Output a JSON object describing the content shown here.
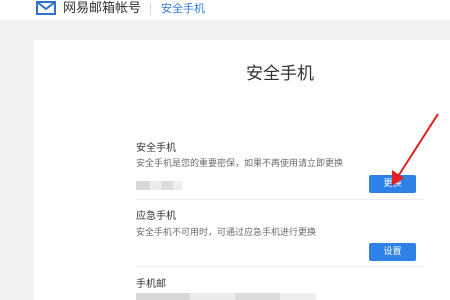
{
  "header": {
    "brand": "网易邮箱帐号",
    "link": "安全手机",
    "icon": "mail-envelope-icon"
  },
  "page": {
    "title": "安全手机"
  },
  "sections": [
    {
      "title": "安全手机",
      "desc": "安全手机是您的重要密保，如果不再使用请立即更换",
      "button": "更换"
    },
    {
      "title": "应急手机",
      "desc": "安全手机不可用时，可通过应急手机进行更换",
      "button": "设置"
    },
    {
      "title": "手机邮"
    }
  ],
  "colors": {
    "accent": "#2f80e7",
    "annotation": "#e02020"
  }
}
